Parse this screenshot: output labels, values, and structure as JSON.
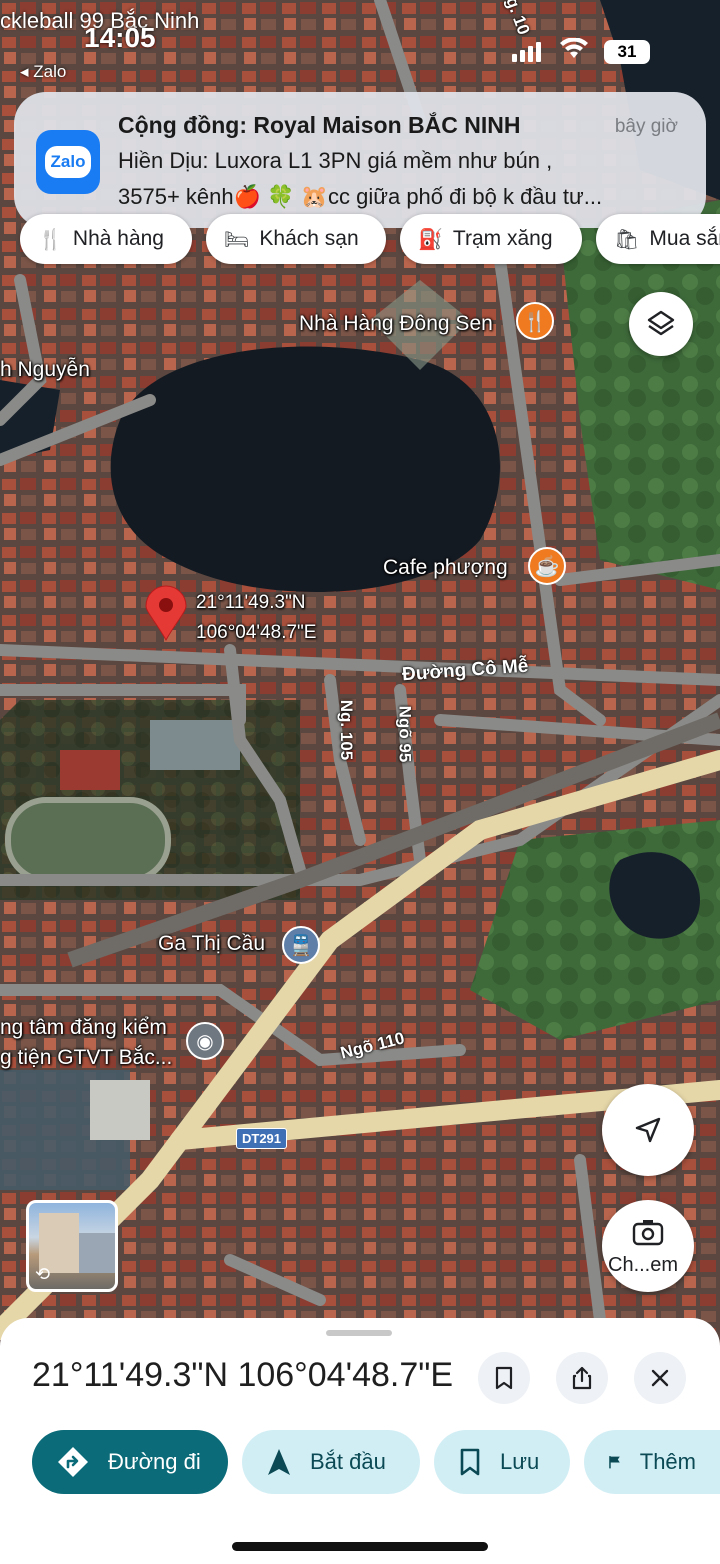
{
  "status_bar": {
    "time": "14:05",
    "back_app": "Zalo",
    "battery": "31",
    "behind_text": "ckleball 99 Bắc Ninh"
  },
  "notification": {
    "app_icon_text": "Zalo",
    "title": "Cộng đồng: Royal Maison BẮC NINH",
    "time": "bây giờ",
    "line1": "Hiền Dịu: Luxora L1 3PN giá mềm như bún ,",
    "line2": "3575+ kênh🍎 🍀 🐹cc giữa phố đi bộ k đầu tư..."
  },
  "chips": [
    {
      "icon": "restaurant-icon",
      "label": "Nhà hàng"
    },
    {
      "icon": "hotel-icon",
      "label": "Khách sạn"
    },
    {
      "icon": "gas-station-icon",
      "label": "Trạm xăng"
    },
    {
      "icon": "shopping-icon",
      "label": "Mua sắm"
    }
  ],
  "map": {
    "labels": {
      "nha_hang": "Nhà Hàng Đông Sen",
      "nguyen": "h Nguyễn",
      "cafe": "Cafe phượng",
      "pin_lat": "21°11'49.3\"N",
      "pin_lng": "106°04'48.7\"E",
      "duong_co_me": "Đường Cô Mễ",
      "ng105": "Ng. 105",
      "ngo95": "Ngõ 95",
      "ga_thi_cau": "Ga Thị Cầu",
      "dang_kiem_1": "ng tâm đăng kiểm",
      "dang_kiem_2": "g tiện GTVT Bắc...",
      "ngo110": "Ngõ 110",
      "dt291": "DT291",
      "ng10": "g. 10"
    }
  },
  "buttons": {
    "capture_label": "Ch...em"
  },
  "sheet": {
    "title": "21°11'49.3\"N 106°04'48.7\"E",
    "actions": [
      {
        "label": "Đường đi"
      },
      {
        "label": "Bắt đầu"
      },
      {
        "label": "Lưu"
      },
      {
        "label": "Thêm"
      }
    ]
  },
  "colors": {
    "primary": "#0b6b78",
    "secondary_bg": "#d2eef5",
    "pin": "#e53935"
  }
}
